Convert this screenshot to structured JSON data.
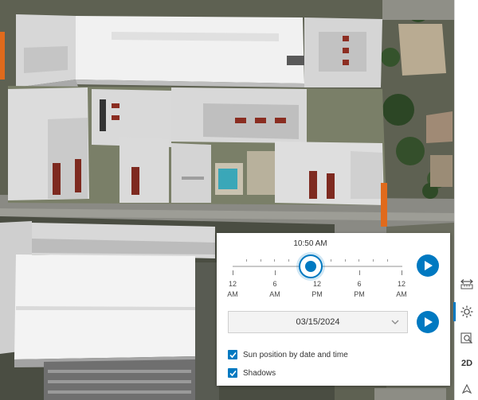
{
  "daylight": {
    "time_label": "10:50 AM",
    "time_value_hours": 10.83,
    "ticks": [
      {
        "hour": "12",
        "period": "AM"
      },
      {
        "hour": "6",
        "period": "AM"
      },
      {
        "hour": "12",
        "period": "PM"
      },
      {
        "hour": "6",
        "period": "PM"
      },
      {
        "hour": "12",
        "period": "AM"
      }
    ],
    "date": "03/15/2024",
    "sun_position_label": "Sun position by date and time",
    "sun_position_checked": true,
    "shadows_label": "Shadows",
    "shadows_checked": true
  },
  "toolbar": {
    "items": [
      {
        "name": "measure-icon"
      },
      {
        "name": "daylight-icon",
        "active": true
      },
      {
        "name": "map-search-icon"
      },
      {
        "name": "view-2d-toggle",
        "label": "2D"
      },
      {
        "name": "compass-icon"
      }
    ]
  },
  "colors": {
    "accent": "#0079c1",
    "panel_bg": "#ffffff",
    "building_white": "#e9e9e9",
    "building_gray": "#cfcfcf"
  }
}
